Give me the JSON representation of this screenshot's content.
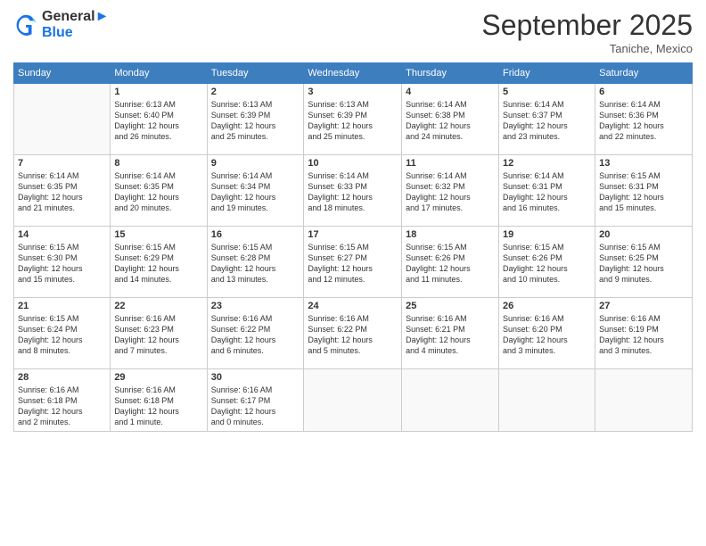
{
  "logo": {
    "line1": "General",
    "line2": "Blue"
  },
  "title": "September 2025",
  "location": "Taniche, Mexico",
  "weekdays": [
    "Sunday",
    "Monday",
    "Tuesday",
    "Wednesday",
    "Thursday",
    "Friday",
    "Saturday"
  ],
  "weeks": [
    [
      {
        "day": "",
        "info": ""
      },
      {
        "day": "1",
        "info": "Sunrise: 6:13 AM\nSunset: 6:40 PM\nDaylight: 12 hours\nand 26 minutes."
      },
      {
        "day": "2",
        "info": "Sunrise: 6:13 AM\nSunset: 6:39 PM\nDaylight: 12 hours\nand 25 minutes."
      },
      {
        "day": "3",
        "info": "Sunrise: 6:13 AM\nSunset: 6:39 PM\nDaylight: 12 hours\nand 25 minutes."
      },
      {
        "day": "4",
        "info": "Sunrise: 6:14 AM\nSunset: 6:38 PM\nDaylight: 12 hours\nand 24 minutes."
      },
      {
        "day": "5",
        "info": "Sunrise: 6:14 AM\nSunset: 6:37 PM\nDaylight: 12 hours\nand 23 minutes."
      },
      {
        "day": "6",
        "info": "Sunrise: 6:14 AM\nSunset: 6:36 PM\nDaylight: 12 hours\nand 22 minutes."
      }
    ],
    [
      {
        "day": "7",
        "info": "Sunrise: 6:14 AM\nSunset: 6:35 PM\nDaylight: 12 hours\nand 21 minutes."
      },
      {
        "day": "8",
        "info": "Sunrise: 6:14 AM\nSunset: 6:35 PM\nDaylight: 12 hours\nand 20 minutes."
      },
      {
        "day": "9",
        "info": "Sunrise: 6:14 AM\nSunset: 6:34 PM\nDaylight: 12 hours\nand 19 minutes."
      },
      {
        "day": "10",
        "info": "Sunrise: 6:14 AM\nSunset: 6:33 PM\nDaylight: 12 hours\nand 18 minutes."
      },
      {
        "day": "11",
        "info": "Sunrise: 6:14 AM\nSunset: 6:32 PM\nDaylight: 12 hours\nand 17 minutes."
      },
      {
        "day": "12",
        "info": "Sunrise: 6:14 AM\nSunset: 6:31 PM\nDaylight: 12 hours\nand 16 minutes."
      },
      {
        "day": "13",
        "info": "Sunrise: 6:15 AM\nSunset: 6:31 PM\nDaylight: 12 hours\nand 15 minutes."
      }
    ],
    [
      {
        "day": "14",
        "info": "Sunrise: 6:15 AM\nSunset: 6:30 PM\nDaylight: 12 hours\nand 15 minutes."
      },
      {
        "day": "15",
        "info": "Sunrise: 6:15 AM\nSunset: 6:29 PM\nDaylight: 12 hours\nand 14 minutes."
      },
      {
        "day": "16",
        "info": "Sunrise: 6:15 AM\nSunset: 6:28 PM\nDaylight: 12 hours\nand 13 minutes."
      },
      {
        "day": "17",
        "info": "Sunrise: 6:15 AM\nSunset: 6:27 PM\nDaylight: 12 hours\nand 12 minutes."
      },
      {
        "day": "18",
        "info": "Sunrise: 6:15 AM\nSunset: 6:26 PM\nDaylight: 12 hours\nand 11 minutes."
      },
      {
        "day": "19",
        "info": "Sunrise: 6:15 AM\nSunset: 6:26 PM\nDaylight: 12 hours\nand 10 minutes."
      },
      {
        "day": "20",
        "info": "Sunrise: 6:15 AM\nSunset: 6:25 PM\nDaylight: 12 hours\nand 9 minutes."
      }
    ],
    [
      {
        "day": "21",
        "info": "Sunrise: 6:15 AM\nSunset: 6:24 PM\nDaylight: 12 hours\nand 8 minutes."
      },
      {
        "day": "22",
        "info": "Sunrise: 6:16 AM\nSunset: 6:23 PM\nDaylight: 12 hours\nand 7 minutes."
      },
      {
        "day": "23",
        "info": "Sunrise: 6:16 AM\nSunset: 6:22 PM\nDaylight: 12 hours\nand 6 minutes."
      },
      {
        "day": "24",
        "info": "Sunrise: 6:16 AM\nSunset: 6:22 PM\nDaylight: 12 hours\nand 5 minutes."
      },
      {
        "day": "25",
        "info": "Sunrise: 6:16 AM\nSunset: 6:21 PM\nDaylight: 12 hours\nand 4 minutes."
      },
      {
        "day": "26",
        "info": "Sunrise: 6:16 AM\nSunset: 6:20 PM\nDaylight: 12 hours\nand 3 minutes."
      },
      {
        "day": "27",
        "info": "Sunrise: 6:16 AM\nSunset: 6:19 PM\nDaylight: 12 hours\nand 3 minutes."
      }
    ],
    [
      {
        "day": "28",
        "info": "Sunrise: 6:16 AM\nSunset: 6:18 PM\nDaylight: 12 hours\nand 2 minutes."
      },
      {
        "day": "29",
        "info": "Sunrise: 6:16 AM\nSunset: 6:18 PM\nDaylight: 12 hours\nand 1 minute."
      },
      {
        "day": "30",
        "info": "Sunrise: 6:16 AM\nSunset: 6:17 PM\nDaylight: 12 hours\nand 0 minutes."
      },
      {
        "day": "",
        "info": ""
      },
      {
        "day": "",
        "info": ""
      },
      {
        "day": "",
        "info": ""
      },
      {
        "day": "",
        "info": ""
      }
    ]
  ]
}
